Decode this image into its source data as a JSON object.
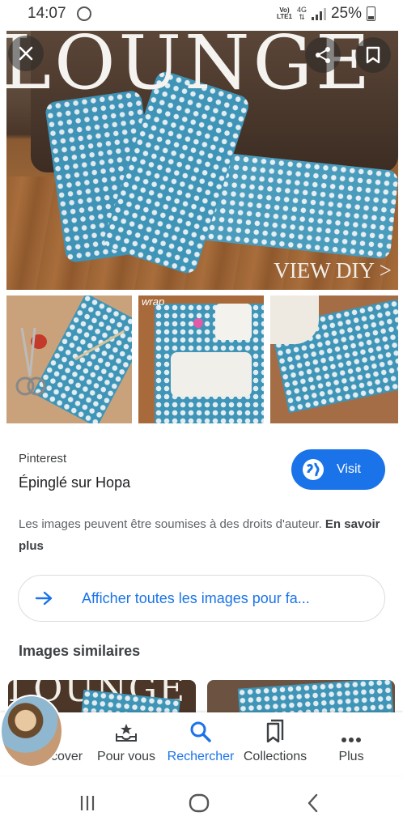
{
  "status_bar": {
    "time": "14:07",
    "volte_label": "VoLTE1",
    "network": "4G",
    "battery": "25%"
  },
  "image_viewer": {
    "hero_title": "LOUNGE",
    "hero_caption": "VIEW DIY >",
    "thumbnail_label": "wrap",
    "close_icon": "close-icon",
    "share_icon": "share-icon",
    "save_icon": "bookmark-icon"
  },
  "result": {
    "source": "Pinterest",
    "title": "Épinglé sur Hopa",
    "visit_label": "Visit",
    "copyright_text": "Les images peuvent être soumises à des droits d'auteur.",
    "learn_more": "En savoir plus",
    "all_images_label": "Afficher toutes les images pour fa...",
    "similar_title": "Images similaires",
    "similar_thumb_title": "LOUNGE"
  },
  "bottom_nav": {
    "items": [
      {
        "label": "Discover",
        "icon": "discover-icon",
        "active": false
      },
      {
        "label": "Pour vous",
        "icon": "inbox-star-icon",
        "active": false
      },
      {
        "label": "Rechercher",
        "icon": "search-icon",
        "active": true
      },
      {
        "label": "Collections",
        "icon": "collections-icon",
        "active": false
      },
      {
        "label": "Plus",
        "icon": "more-icon",
        "active": false
      }
    ]
  },
  "system_nav": {
    "recents": "recents-icon",
    "home": "home-icon",
    "back": "back-icon"
  },
  "colors": {
    "accent": "#1a73e8",
    "fabric": "#3e95b7"
  }
}
